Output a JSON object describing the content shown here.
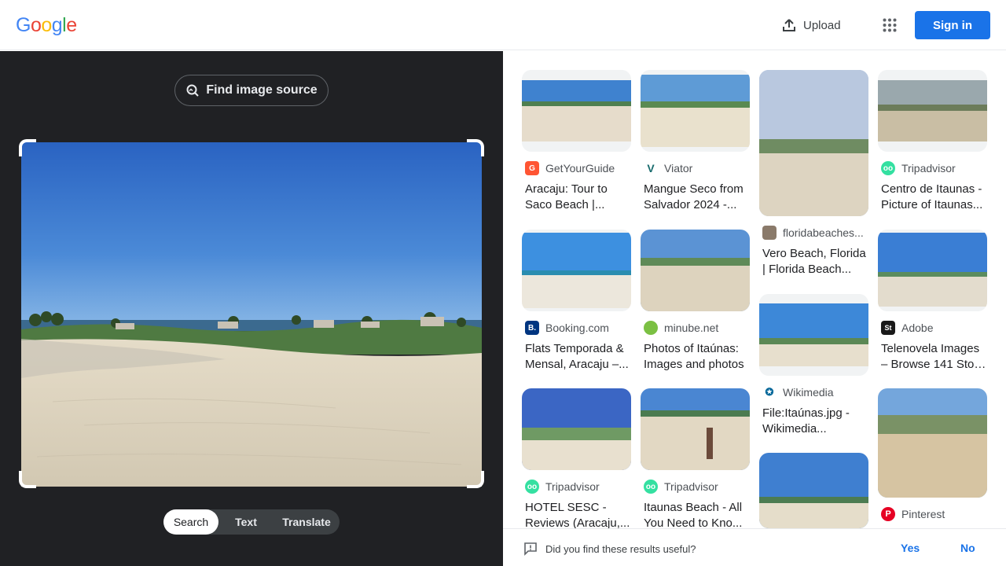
{
  "header": {
    "logo": [
      "G",
      "o",
      "o",
      "g",
      "l",
      "e"
    ],
    "upload_label": "Upload",
    "signin_label": "Sign in",
    "colors": {
      "accent": "#1a73e8",
      "logo_blue": "#4285f4",
      "logo_red": "#ea4335",
      "logo_yellow": "#fbbc05",
      "logo_green": "#34a853"
    }
  },
  "lens": {
    "find_source_label": "Find image source",
    "modes": [
      "Search",
      "Text",
      "Translate"
    ],
    "active_mode": "Search"
  },
  "results": [
    {
      "source": "GetYourGuide",
      "icon": "getyourguide-favicon",
      "title1": "Aracaju: Tour to",
      "title2": "Saco Beach |..."
    },
    {
      "source": "Viator",
      "icon": "viator-favicon",
      "title1": "Mangue Seco from",
      "title2": "Salvador 2024 -..."
    },
    {
      "source": "floridabeaches...",
      "icon": "floridabeaches-favicon",
      "title1": "Vero Beach, Florida",
      "title2": "| Florida Beach..."
    },
    {
      "source": "Tripadvisor",
      "icon": "tripadvisor-favicon",
      "title1": "Centro de Itaunas -",
      "title2": "Picture of Itaunas..."
    },
    {
      "source": "Booking.com",
      "icon": "booking-favicon",
      "title1": "Flats Temporada &",
      "title2": "Mensal, Aracaju –..."
    },
    {
      "source": "minube.net",
      "icon": "minube-favicon",
      "title1": "Photos of Itaúnas:",
      "title2": "Images and photos"
    },
    {
      "source": "Wikimedia",
      "icon": "wikimedia-favicon",
      "title1": "File:Itaúnas.jpg -",
      "title2": "Wikimedia..."
    },
    {
      "source": "Adobe",
      "icon": "adobe-stock-favicon",
      "title1": "Telenovela Images",
      "title2": "– Browse 141 Stoc..."
    },
    {
      "source": "Tripadvisor",
      "icon": "tripadvisor-favicon",
      "title1": "HOTEL SESC -",
      "title2": "Reviews (Aracaju,..."
    },
    {
      "source": "Tripadvisor",
      "icon": "tripadvisor-favicon",
      "title1": "Itaunas Beach - All",
      "title2": "You Need to Kno..."
    },
    {
      "source": "Pinterest",
      "icon": "pinterest-favicon",
      "title1": "",
      "title2": ""
    }
  ],
  "feedback": {
    "question": "Did you find these results useful?",
    "yes_label": "Yes",
    "no_label": "No"
  }
}
